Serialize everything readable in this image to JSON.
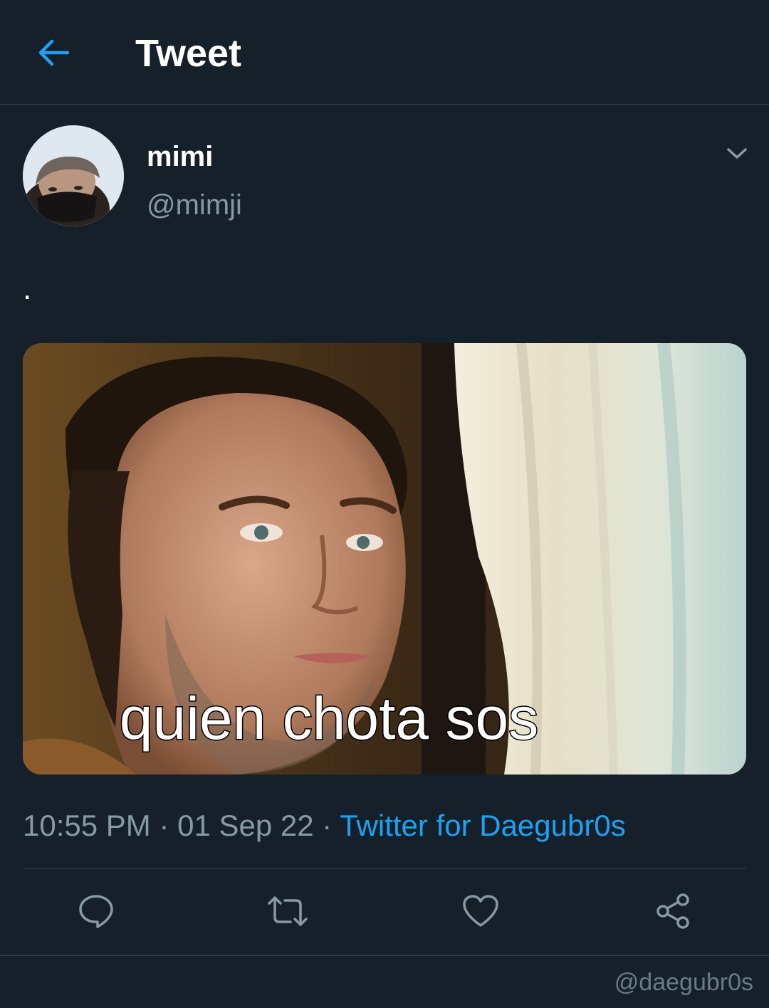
{
  "header": {
    "title": "Tweet",
    "back_icon": "arrow-left-icon"
  },
  "author": {
    "display_name": "mimi",
    "handle": "@mimji"
  },
  "tweet": {
    "text": ".",
    "media_caption": "quien chota sos"
  },
  "meta": {
    "time": "10:55 PM",
    "sep1": " · ",
    "date": "01 Sep 22",
    "sep2": " · ",
    "source": "Twitter for Daegubr0s"
  },
  "actions": {
    "reply_icon": "reply-icon",
    "retweet_icon": "retweet-icon",
    "like_icon": "heart-icon",
    "share_icon": "share-icon"
  },
  "watermark": "@daegubr0s",
  "colors": {
    "background": "#15202b",
    "border": "#38444d",
    "secondary_text": "#8899a6",
    "accent": "#1da1f2"
  }
}
